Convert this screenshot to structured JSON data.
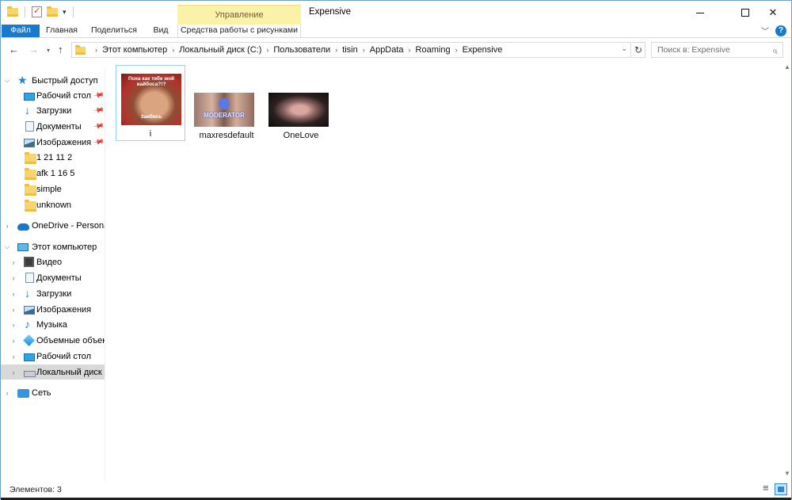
{
  "window": {
    "title": "Expensive",
    "context_tab": "Управление",
    "controls": {
      "minimize": "—",
      "maximize": "☐",
      "close": "✕"
    }
  },
  "ribbon": {
    "tabs": [
      "Файл",
      "Главная",
      "Поделиться",
      "Вид",
      "Средства работы с рисунками"
    ],
    "active_tab": "Файл",
    "accent": "#1979ca",
    "context_color": "#fbf1a9"
  },
  "nav": {
    "breadcrumbs": [
      "Этот компьютер",
      "Локальный диск (C:)",
      "Пользователи",
      "tisin",
      "AppData",
      "Roaming",
      "Expensive"
    ],
    "search_placeholder": "Поиск в: Expensive"
  },
  "sidebar": {
    "quick_access": {
      "label": "Быстрый доступ",
      "items": [
        {
          "label": "Рабочий стол",
          "icon": "desktop-icon",
          "pinned": true
        },
        {
          "label": "Загрузки",
          "icon": "download-icon",
          "pinned": true
        },
        {
          "label": "Документы",
          "icon": "documents-icon",
          "pinned": true
        },
        {
          "label": "Изображения",
          "icon": "pictures-icon",
          "pinned": true
        },
        {
          "label": "1 21 11 2",
          "icon": "folder-icon",
          "pinned": false
        },
        {
          "label": "afk 1 16 5",
          "icon": "folder-icon",
          "pinned": false
        },
        {
          "label": "simple",
          "icon": "folder-icon",
          "pinned": false
        },
        {
          "label": "unknown",
          "icon": "folder-icon",
          "pinned": false
        }
      ]
    },
    "onedrive": {
      "label": "OneDrive - Personal"
    },
    "this_pc": {
      "label": "Этот компьютер",
      "items": [
        {
          "label": "Видео",
          "icon": "video-icon"
        },
        {
          "label": "Документы",
          "icon": "documents-icon"
        },
        {
          "label": "Загрузки",
          "icon": "download-icon"
        },
        {
          "label": "Изображения",
          "icon": "pictures-icon"
        },
        {
          "label": "Музыка",
          "icon": "music-icon"
        },
        {
          "label": "Объемные объекты",
          "icon": "3d-objects-icon"
        },
        {
          "label": "Рабочий стол",
          "icon": "desktop-icon"
        },
        {
          "label": "Локальный диск (C:)",
          "icon": "local-disk-icon",
          "selected": true
        }
      ]
    },
    "network": {
      "label": "Сеть"
    }
  },
  "files": [
    {
      "name": "i",
      "caption_top": "Пока как тебе мой вайбоса?!?",
      "caption_bottom": "Заебись",
      "selected": true
    },
    {
      "name": "maxresdefault",
      "caption": "MODERATOR"
    },
    {
      "name": "OneLove"
    }
  ],
  "status": {
    "items_count": "Элементов: 3"
  }
}
